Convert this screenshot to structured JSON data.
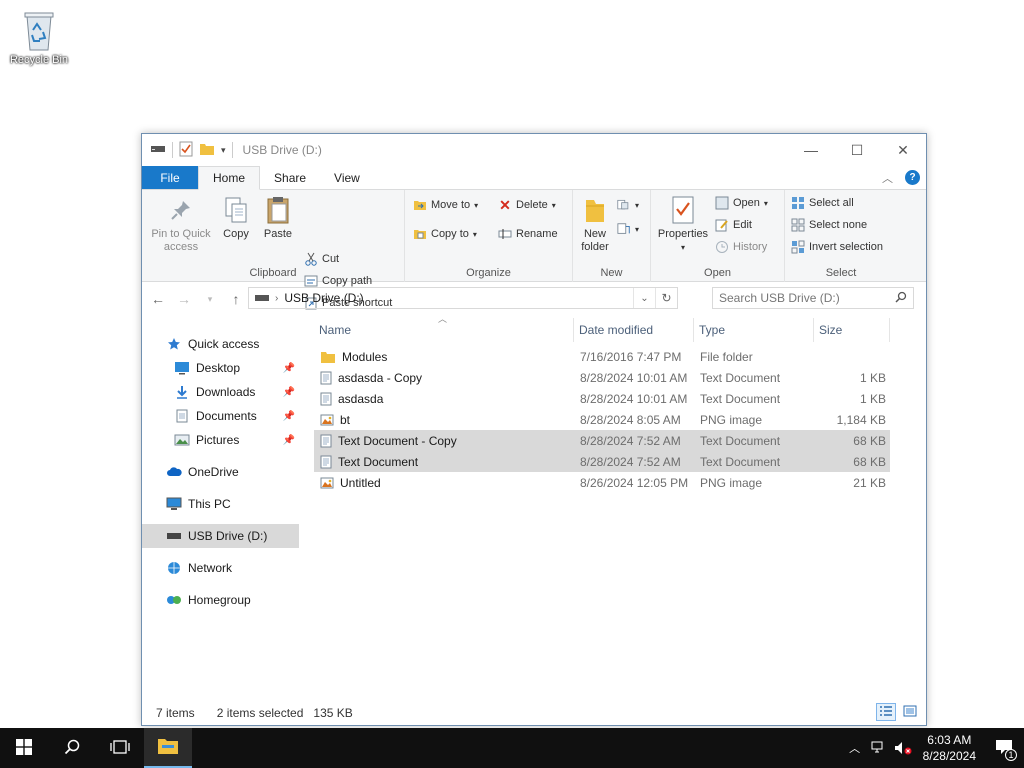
{
  "desktop": {
    "recycle_bin_label": "Recycle Bin"
  },
  "window": {
    "title": "USB Drive (D:)",
    "controls": {
      "minimize": "—",
      "maximize": "☐",
      "close": "✕"
    }
  },
  "ribbon": {
    "tabs": [
      "File",
      "Home",
      "Share",
      "View"
    ],
    "active_tab": "Home",
    "clipboard": {
      "label": "Clipboard",
      "pin": "Pin to Quick access",
      "copy": "Copy",
      "paste": "Paste",
      "cut": "Cut",
      "copy_path": "Copy path",
      "paste_shortcut": "Paste shortcut"
    },
    "organize": {
      "label": "Organize",
      "move_to": "Move to",
      "copy_to": "Copy to",
      "delete": "Delete",
      "rename": "Rename"
    },
    "new": {
      "label": "New",
      "new_folder": "New folder"
    },
    "open": {
      "label": "Open",
      "properties": "Properties",
      "open": "Open",
      "edit": "Edit",
      "history": "History"
    },
    "select": {
      "label": "Select",
      "select_all": "Select all",
      "select_none": "Select none",
      "invert": "Invert selection"
    }
  },
  "address": {
    "path": "USB Drive (D:)",
    "search_placeholder": "Search USB Drive (D:)"
  },
  "nav": {
    "quick_access": "Quick access",
    "desktop": "Desktop",
    "downloads": "Downloads",
    "documents": "Documents",
    "pictures": "Pictures",
    "onedrive": "OneDrive",
    "this_pc": "This PC",
    "usb": "USB Drive (D:)",
    "network": "Network",
    "homegroup": "Homegroup"
  },
  "columns": {
    "name": "Name",
    "date": "Date modified",
    "type": "Type",
    "size": "Size"
  },
  "files": [
    {
      "name": "Modules",
      "date": "7/16/2016 7:47 PM",
      "type": "File folder",
      "size": "",
      "icon": "folder-icon",
      "selected": false
    },
    {
      "name": "asdasda - Copy",
      "date": "8/28/2024 10:01 AM",
      "type": "Text Document",
      "size": "1 KB",
      "icon": "text-file-icon",
      "selected": false
    },
    {
      "name": "asdasda",
      "date": "8/28/2024 10:01 AM",
      "type": "Text Document",
      "size": "1 KB",
      "icon": "text-file-icon",
      "selected": false
    },
    {
      "name": "bt",
      "date": "8/28/2024 8:05 AM",
      "type": "PNG image",
      "size": "1,184 KB",
      "icon": "image-file-icon",
      "selected": false
    },
    {
      "name": "Text Document - Copy",
      "date": "8/28/2024 7:52 AM",
      "type": "Text Document",
      "size": "68 KB",
      "icon": "text-file-icon",
      "selected": true
    },
    {
      "name": "Text Document",
      "date": "8/28/2024 7:52 AM",
      "type": "Text Document",
      "size": "68 KB",
      "icon": "text-file-icon",
      "selected": true
    },
    {
      "name": "Untitled",
      "date": "8/26/2024 12:05 PM",
      "type": "PNG image",
      "size": "21 KB",
      "icon": "image-file-icon",
      "selected": false
    }
  ],
  "status": {
    "items": "7 items",
    "selected": "2 items selected",
    "size": "135 KB"
  },
  "taskbar": {
    "time": "6:03 AM",
    "date": "8/28/2024",
    "notification_count": "1"
  },
  "colors": {
    "accent": "#1979ca",
    "selection": "#d9d9d9",
    "taskbar": "#101010",
    "folder": "#f0c040"
  }
}
